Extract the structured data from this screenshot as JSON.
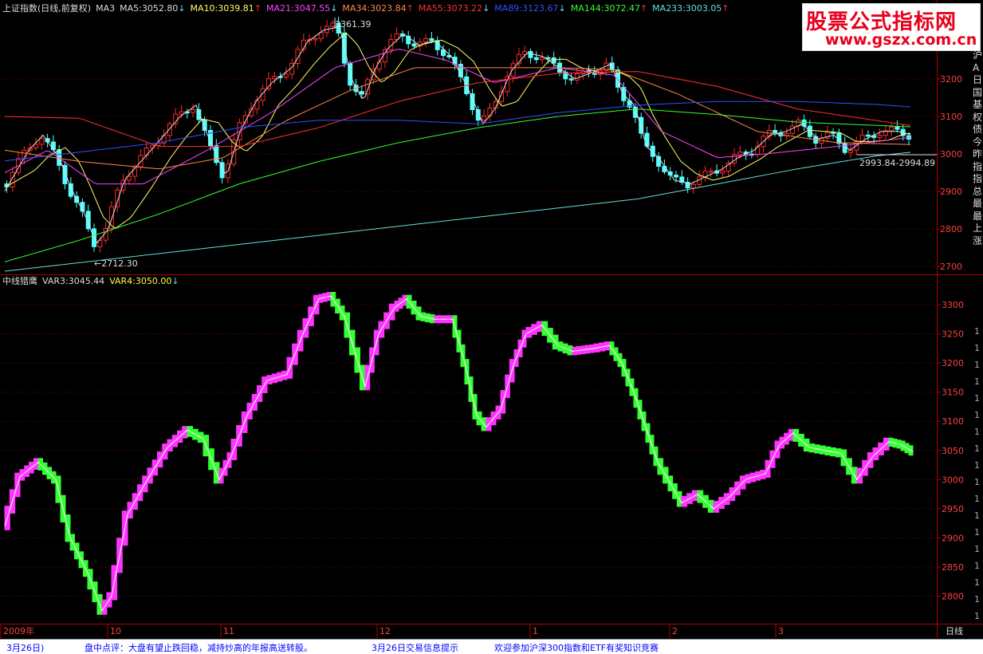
{
  "upper_header": {
    "title": "上证指数(日线,前复权)",
    "items": [
      {
        "label": "MA3",
        "color": "#dddddd",
        "arrow": ""
      },
      {
        "label": "MA5:3052.80",
        "color": "#dddddd",
        "arrow": "↓"
      },
      {
        "label": "MA10:3039.81",
        "color": "#ffff66",
        "arrow": "↑"
      },
      {
        "label": "MA21:3047.55",
        "color": "#ff44ff",
        "arrow": "↓"
      },
      {
        "label": "MA34:3023.84",
        "color": "#ff8844",
        "arrow": "↑"
      },
      {
        "label": "MA55:3073.22",
        "color": "#ff3030",
        "arrow": "↓"
      },
      {
        "label": "MA89:3123.67",
        "color": "#3050ff",
        "arrow": "↓"
      },
      {
        "label": "MA144:3072.47",
        "color": "#33ff33",
        "arrow": "↑"
      },
      {
        "label": "MA233:3003.05",
        "color": "#66dddd",
        "arrow": "↑"
      }
    ]
  },
  "lower_header": {
    "title": "中线猎鹰",
    "items": [
      {
        "label": "VAR3:3045.44",
        "color": "#dddddd",
        "arrow": ""
      },
      {
        "label": "VAR4:3050.00",
        "color": "#ffff44",
        "arrow": "↓"
      }
    ]
  },
  "watermark": {
    "title": "股票公式指标网",
    "url": "www.gszx.com.cn"
  },
  "upper_axis": [
    "3200",
    "3100",
    "3000",
    "2900",
    "2800",
    "2700"
  ],
  "lower_axis": [
    "3300",
    "3250",
    "3200",
    "3150",
    "3100",
    "3050",
    "3000",
    "2950",
    "2900",
    "2850",
    "2800"
  ],
  "annotations": {
    "high": "3361.39",
    "low": "←2712.30",
    "last": "2993.84-2994.89"
  },
  "x_axis": [
    "2009年",
    "10",
    "11",
    "12",
    "1",
    "2",
    "3"
  ],
  "period_label": "日线",
  "right_info_chars": [
    "沪",
    "A",
    "日",
    "国",
    "基",
    "权",
    "债",
    "今",
    "昨",
    "指",
    "指",
    "总",
    "最",
    "最",
    "上",
    "涨"
  ],
  "right_info_chars_lower": [
    "1",
    "1",
    "1",
    "1",
    "1",
    "1",
    "1",
    "1",
    "1",
    "1",
    "1",
    "1",
    "1",
    "1",
    "1",
    "1",
    "1",
    "1"
  ],
  "status_bar": {
    "date": "3月26日)",
    "comment": "盘中点评：大盘有望止跌回稳，减持炒高的年报高送转股。",
    "notice": "3月26日交易信息提示",
    "promo": "欢迎参加沪深300指数和ETF有奖知识竞赛"
  },
  "colors": {
    "up": "#ff2a2a",
    "down": "#54ffff",
    "var_up": "#ff33ff",
    "var_down": "#33ff33",
    "grid": "#8b0000"
  }
}
